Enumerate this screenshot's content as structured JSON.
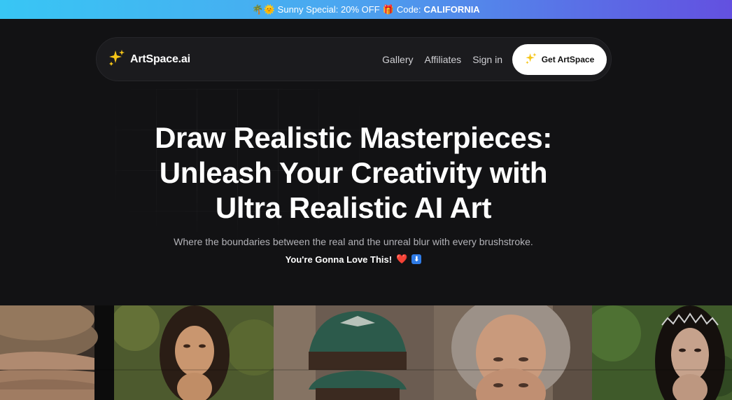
{
  "promo": {
    "emoji_left": "🌴🌞",
    "text": "Sunny Special: 20% OFF",
    "gift_emoji": "🎁",
    "code_label": "Code:",
    "code": "CALIFORNIA"
  },
  "nav": {
    "logo_text": "ArtSpace.ai",
    "links": [
      "Gallery",
      "Affiliates",
      "Sign in"
    ],
    "cta_label": "Get ArtSpace"
  },
  "hero": {
    "headline_lines": [
      "Draw Realistic Masterpieces:",
      "Unleash Your Creativity with",
      "Ultra Realistic AI Art"
    ],
    "subtitle": "Where the boundaries between the real and the unreal blur with every brushstroke.",
    "tagline": "You're Gonna Love This!",
    "tagline_heart": "❤️",
    "tagline_arrow": "⬇"
  },
  "gallery": {
    "tiles": [
      {
        "subject": "old man with brown hat",
        "bg": "#4a3f35",
        "face": "#b08a70"
      },
      {
        "subject": "young woman dark hair",
        "bg": "#4d5a2e",
        "face": "#c9966f"
      },
      {
        "subject": "man in green cap",
        "bg": "#5e5148",
        "face": "#b88a68"
      },
      {
        "subject": "older woman grey hair",
        "bg": "#6b5a4c",
        "face": "#c99a7c"
      },
      {
        "subject": "woman with crown",
        "bg": "#3f5a2a",
        "face": "#c6a28c"
      }
    ]
  },
  "colors": {
    "accent_star": "#f5c518",
    "promo_start": "#38c6f4",
    "promo_end": "#6350e0"
  }
}
